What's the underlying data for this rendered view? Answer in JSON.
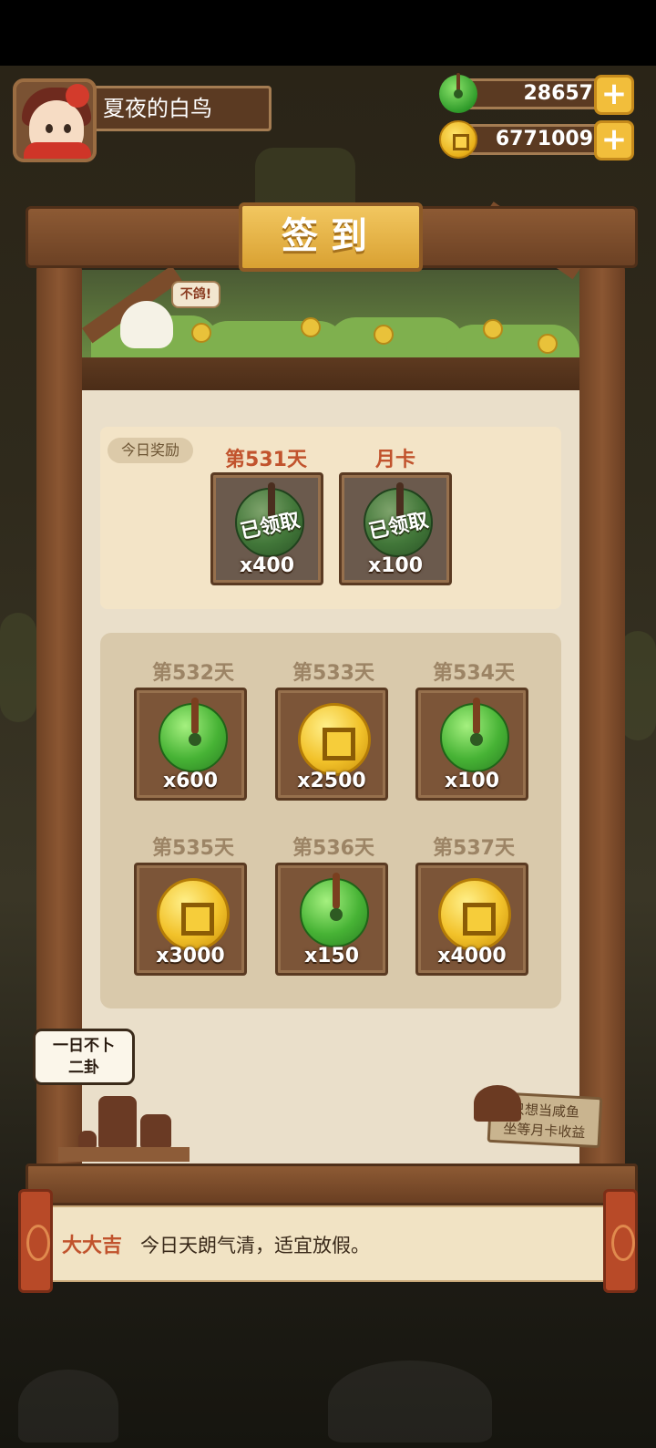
{
  "player": {
    "name": "夏夜的白鸟"
  },
  "resources": {
    "jade": "28657",
    "coins": "6771009",
    "add_symbol": "+"
  },
  "title": "签到",
  "chick_bubble": "不鸽!",
  "today": {
    "tag": "今日奖励",
    "rewards": [
      {
        "day": "第531天",
        "amount": "x400",
        "status": "已领取",
        "item": "jade"
      },
      {
        "day": "月卡",
        "amount": "x100",
        "status": "已领取",
        "item": "jade"
      }
    ]
  },
  "upcoming": [
    {
      "day": "第532天",
      "amount": "x600",
      "item": "jade"
    },
    {
      "day": "第533天",
      "amount": "x2500",
      "item": "coin"
    },
    {
      "day": "第534天",
      "amount": "x100",
      "item": "jade"
    },
    {
      "day": "第535天",
      "amount": "x3000",
      "item": "coin"
    },
    {
      "day": "第536天",
      "amount": "x150",
      "item": "jade"
    },
    {
      "day": "第537天",
      "amount": "x4000",
      "item": "coin"
    }
  ],
  "speech": {
    "line1": "一日不卜",
    "line2": "二卦"
  },
  "sign": {
    "line1": "只想当咸鱼",
    "line2": "坐等月卡收益"
  },
  "fortune": {
    "level": "大大吉",
    "text": "今日天朗气清，适宜放假。"
  }
}
